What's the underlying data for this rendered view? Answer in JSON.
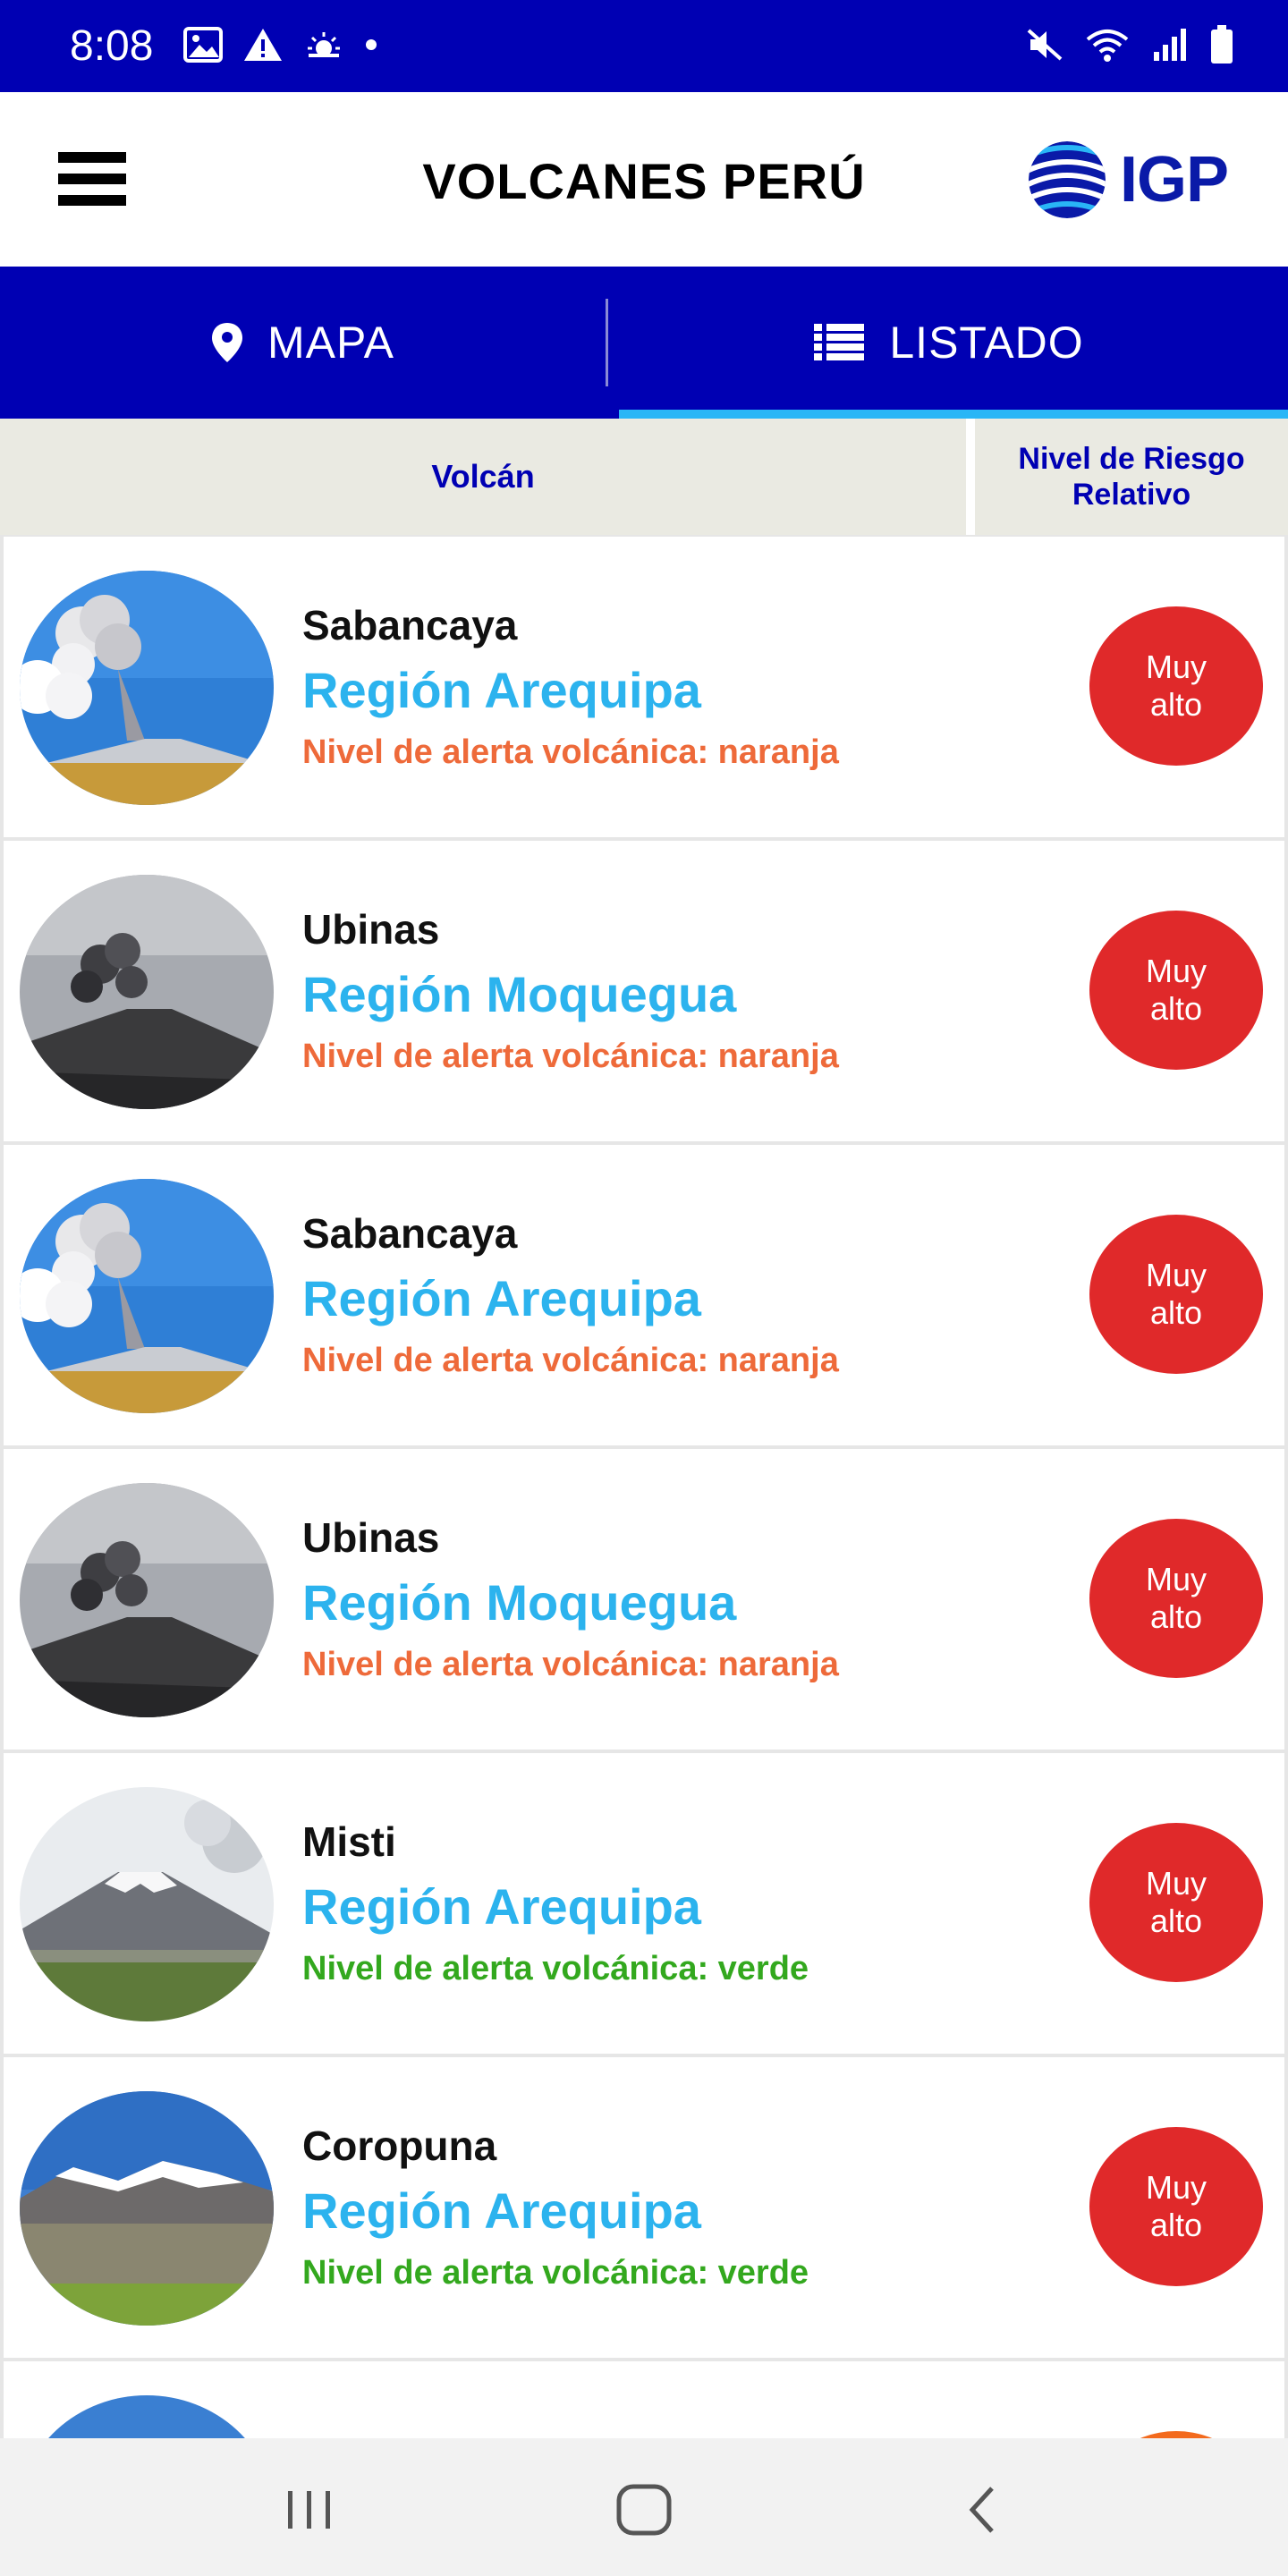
{
  "status_bar": {
    "time": "8:08",
    "left_icons": [
      "image-icon",
      "warning-icon",
      "weather-icon",
      "dot-icon"
    ],
    "right_icons": [
      "mute-icon",
      "wifi-icon",
      "signal-icon",
      "battery-icon"
    ]
  },
  "header": {
    "title": "VOLCANES PERÚ",
    "logo_text": "IGP",
    "menu_icon": "hamburger-menu-icon"
  },
  "tabs": [
    {
      "label": "MAPA",
      "icon": "map-pin-icon",
      "active": false
    },
    {
      "label": "LISTADO",
      "icon": "list-icon",
      "active": true
    }
  ],
  "columns": {
    "volcano": "Volcán",
    "risk_line1": "Nivel de Riesgo",
    "risk_line2": "Relativo"
  },
  "volcanoes": [
    {
      "name": "Sabancaya",
      "region": "Región Arequipa",
      "alert": "Nivel de alerta volcánica: naranja",
      "alert_color": "#ee6a3a",
      "risk_line1": "Muy",
      "risk_line2": "alto",
      "risk_color": "#e0292a",
      "image": "sabancaya-photo"
    },
    {
      "name": "Ubinas",
      "region": "Región Moquegua",
      "alert": "Nivel de alerta volcánica: naranja",
      "alert_color": "#ee6a3a",
      "risk_line1": "Muy",
      "risk_line2": "alto",
      "risk_color": "#e0292a",
      "image": "ubinas-photo"
    },
    {
      "name": "Sabancaya",
      "region": "Región Arequipa",
      "alert": "Nivel de alerta volcánica: naranja",
      "alert_color": "#ee6a3a",
      "risk_line1": "Muy",
      "risk_line2": "alto",
      "risk_color": "#e0292a",
      "image": "sabancaya-photo"
    },
    {
      "name": "Ubinas",
      "region": "Región Moquegua",
      "alert": "Nivel de alerta volcánica: naranja",
      "alert_color": "#ee6a3a",
      "risk_line1": "Muy",
      "risk_line2": "alto",
      "risk_color": "#e0292a",
      "image": "ubinas-photo"
    },
    {
      "name": "Misti",
      "region": "Región Arequipa",
      "alert": "Nivel de alerta volcánica: verde",
      "alert_color": "#33a81e",
      "risk_line1": "Muy",
      "risk_line2": "alto",
      "risk_color": "#e0292a",
      "image": "misti-photo"
    },
    {
      "name": "Coropuna",
      "region": "Región Arequipa",
      "alert": "Nivel de alerta volcánica: verde",
      "alert_color": "#33a81e",
      "risk_line1": "Muy",
      "risk_line2": "alto",
      "risk_color": "#e0292a",
      "image": "coropuna-photo"
    }
  ],
  "nav_bar": {
    "buttons": [
      "recent-apps-icon",
      "home-icon",
      "back-icon"
    ]
  },
  "colors": {
    "brand_blue": "#0000b3",
    "accent_cyan": "#29b6f6",
    "risk_red": "#e0292a",
    "risk_orange": "#f36a1d"
  }
}
